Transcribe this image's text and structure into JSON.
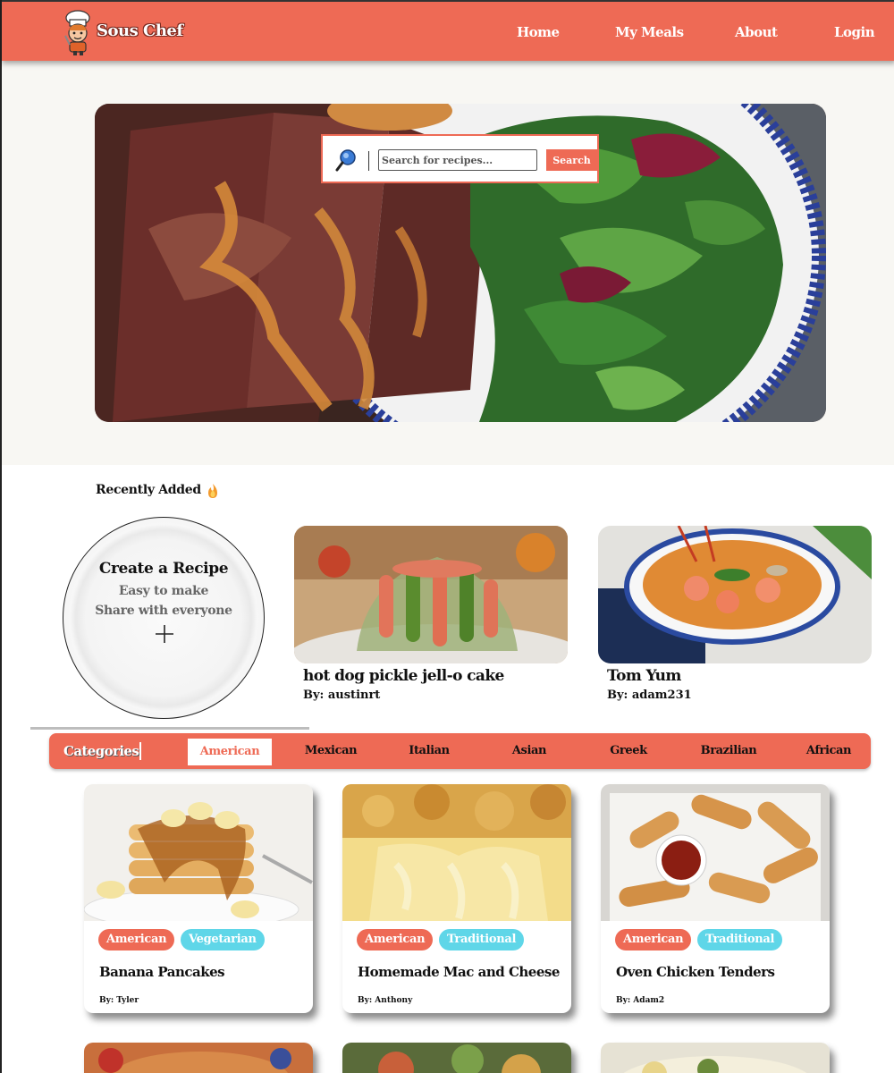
{
  "nav": {
    "brand": "Sous Chef",
    "links": [
      "Home",
      "My Meals",
      "About",
      "Login"
    ]
  },
  "search": {
    "placeholder": "Search for recipes...",
    "button": "Search"
  },
  "recent": {
    "title": "Recently Added",
    "create": {
      "title": "Create a Recipe",
      "line1": "Easy to make",
      "line2": "Share with everyone"
    },
    "cards": [
      {
        "name": "hot dog pickle jell-o cake",
        "by": "By: austinrt"
      },
      {
        "name": "Tom Yum",
        "by": "By: adam231"
      }
    ]
  },
  "categories": {
    "label": "Categories",
    "items": [
      "American",
      "Mexican",
      "Italian",
      "Asian",
      "Greek",
      "Brazilian",
      "African"
    ],
    "active": "American"
  },
  "recipes": [
    {
      "name": "Banana Pancakes",
      "by": "By: Tyler",
      "tags": [
        "American",
        "Vegetarian"
      ]
    },
    {
      "name": "Homemade Mac and Cheese",
      "by": "By: Anthony",
      "tags": [
        "American",
        "Traditional"
      ]
    },
    {
      "name": "Oven Chicken Tenders",
      "by": "By: Adam2",
      "tags": [
        "American",
        "Traditional"
      ]
    }
  ],
  "colors": {
    "brand": "#ee6a55",
    "tag_secondary": "#5fd6e8",
    "hero_background": "#f8f7f3"
  }
}
